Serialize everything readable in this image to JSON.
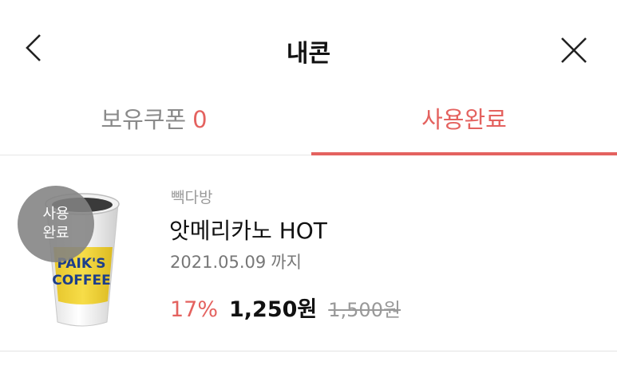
{
  "header": {
    "title": "내콘",
    "back_icon": "chevron-left-icon",
    "close_icon": "close-icon"
  },
  "tabs": [
    {
      "label": "보유쿠폰",
      "count": "0",
      "active": false
    },
    {
      "label": "사용완료",
      "active": true
    }
  ],
  "colors": {
    "accent": "#e4625f"
  },
  "coupons": [
    {
      "badge": "사용\n완료",
      "brand": "빽다방",
      "name": "앗메리카노 HOT",
      "expiry": "2021.05.09",
      "expiry_suffix": "까지",
      "discount": "17%",
      "price": "1,250원",
      "original_price": "1,500원",
      "cup_text": "PAIK'S COFFEE"
    }
  ]
}
